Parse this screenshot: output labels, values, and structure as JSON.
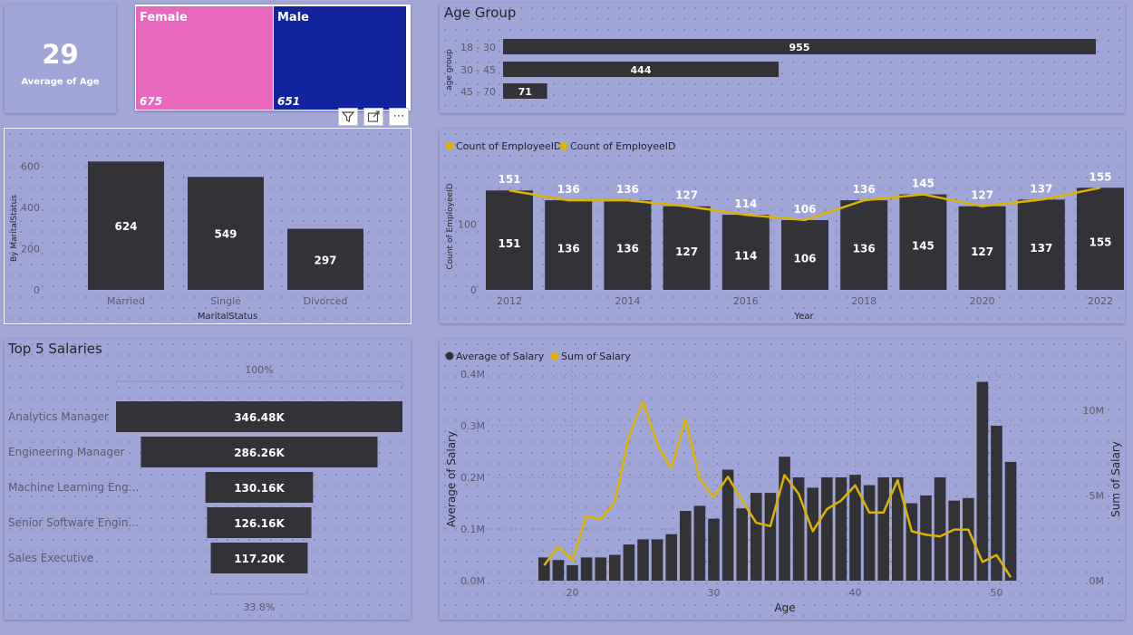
{
  "kpi": {
    "value": "29",
    "label": "Average of Age"
  },
  "gender": {
    "female": {
      "label": "Female",
      "value": "675",
      "color": "#e868bd"
    },
    "male": {
      "label": "Male",
      "value": "651",
      "color": "#12239e"
    }
  },
  "age_group": {
    "title": "Age Group",
    "axis_label": "age group",
    "categories": [
      "18 - 30",
      "30 - 45",
      "45 - 70"
    ],
    "values": [
      955,
      444,
      71
    ],
    "bar_color": "#333236"
  },
  "marital": {
    "ylabel": "By MaritalStatus",
    "xlabel": "MaritalStatus",
    "yticks": [
      "0",
      "200",
      "400",
      "600"
    ],
    "categories": [
      "Married",
      "Single",
      "Divorced"
    ],
    "values": [
      624,
      549,
      297
    ]
  },
  "yearly": {
    "legend": [
      "Count of EmployeeID",
      "Count of EmployeeID"
    ],
    "ylabel": "Count of EmployeeID",
    "xlabel": "Year",
    "yticks": [
      "0",
      "100"
    ],
    "xticks": [
      "2012",
      "2014",
      "2016",
      "2018",
      "2020",
      "2022"
    ],
    "line_color": "#e0b200"
  },
  "salaries": {
    "title": "Top 5 Salaries",
    "top_pct": "100%",
    "bottom_pct": "33.8%",
    "categories": [
      "Analytics Manager",
      "Engineering Manager",
      "Machine Learning Eng...",
      "Senior Software Engin...",
      "Sales Executive"
    ],
    "values": [
      346.48,
      286.26,
      130.16,
      126.16,
      117.2
    ],
    "labels": [
      "346.48K",
      "286.26K",
      "130.16K",
      "126.16K",
      "117.20K"
    ]
  },
  "age_salary": {
    "legend": [
      "Average of Salary",
      "Sum of Salary"
    ],
    "ylabel_left": "Average of Salary",
    "ylabel_right": "Sum of Salary",
    "xlabel": "Age",
    "left_ticks": [
      "0.0M",
      "0.1M",
      "0.2M",
      "0.3M",
      "0.4M"
    ],
    "right_ticks": [
      "0M",
      "5M",
      "10M"
    ],
    "xticks": [
      "20",
      "30",
      "40",
      "50"
    ]
  },
  "chart_data": [
    {
      "type": "bar",
      "title": "Age Group",
      "ylabel": "age group",
      "categories": [
        "18 - 30",
        "30 - 45",
        "45 - 70"
      ],
      "values": [
        955,
        444,
        71
      ]
    },
    {
      "type": "bar",
      "xlabel": "MaritalStatus",
      "ylabel": "By MaritalStatus",
      "categories": [
        "Married",
        "Single",
        "Divorced"
      ],
      "values": [
        624,
        549,
        297
      ],
      "ylim": [
        0,
        650
      ]
    },
    {
      "type": "bar",
      "xlabel": "Year",
      "ylabel": "Count of EmployeeID",
      "x": [
        2012,
        2013,
        2014,
        2015,
        2016,
        2017,
        2018,
        2019,
        2020,
        2021,
        2022
      ],
      "series": [
        {
          "name": "Count of EmployeeID",
          "kind": "bar",
          "values": [
            151,
            136,
            136,
            127,
            114,
            106,
            136,
            145,
            127,
            137,
            155
          ]
        },
        {
          "name": "Count of EmployeeID",
          "kind": "line",
          "values": [
            151,
            136,
            136,
            127,
            114,
            106,
            136,
            145,
            127,
            137,
            155
          ]
        }
      ],
      "ylim": [
        0,
        180
      ]
    },
    {
      "type": "bar",
      "title": "Top 5 Salaries",
      "categories": [
        "Analytics Manager",
        "Engineering Manager",
        "Machine Learning Eng...",
        "Senior Software Engin...",
        "Sales Executive"
      ],
      "values": [
        346.48,
        286.26,
        130.16,
        126.16,
        117.2
      ],
      "unit": "K"
    },
    {
      "type": "bar",
      "xlabel": "Age",
      "ylabel": "Average of Salary",
      "ylabel_right": "Sum of Salary",
      "x": [
        18,
        19,
        20,
        21,
        22,
        23,
        24,
        25,
        26,
        27,
        28,
        29,
        30,
        31,
        32,
        33,
        34,
        35,
        36,
        37,
        38,
        39,
        40,
        41,
        42,
        43,
        44,
        45,
        46,
        47,
        48,
        49,
        50,
        51
      ],
      "series": [
        {
          "name": "Average of Salary",
          "kind": "bar",
          "axis": "left",
          "values": [
            0.045,
            0.04,
            0.03,
            0.045,
            0.045,
            0.05,
            0.07,
            0.08,
            0.08,
            0.09,
            0.135,
            0.145,
            0.12,
            0.215,
            0.14,
            0.17,
            0.17,
            0.24,
            0.2,
            0.18,
            0.2,
            0.2,
            0.205,
            0.185,
            0.2,
            0.2,
            0.15,
            0.165,
            0.2,
            0.155,
            0.16,
            0.385,
            0.3,
            0.23
          ]
        },
        {
          "name": "Sum of Salary",
          "kind": "line",
          "axis": "right",
          "values": [
            0.9,
            2.0,
            1.2,
            3.8,
            3.6,
            4.6,
            8.5,
            10.5,
            8.0,
            6.6,
            9.5,
            6.0,
            4.9,
            6.1,
            4.7,
            3.4,
            3.2,
            6.2,
            5.1,
            2.9,
            4.2,
            4.7,
            5.6,
            4.0,
            4.0,
            5.9,
            2.9,
            2.7,
            2.6,
            3.0,
            3.0,
            1.1,
            1.5,
            0.2
          ]
        }
      ],
      "ylim": [
        0,
        0.4
      ],
      "ylim_right": [
        0,
        11.5
      ]
    }
  ]
}
